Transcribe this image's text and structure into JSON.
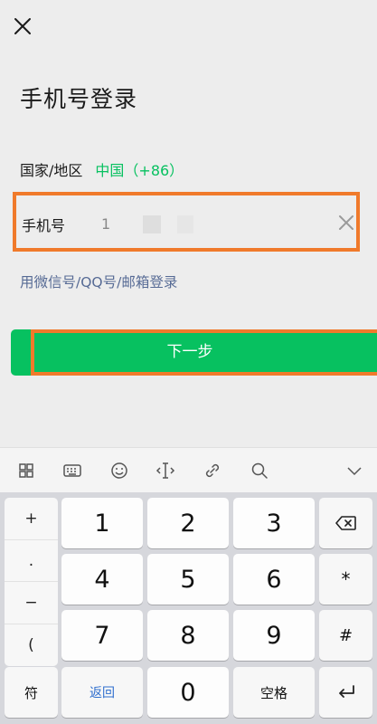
{
  "header": {
    "close_icon": "close-icon",
    "title": "手机号登录"
  },
  "form": {
    "region_label": "国家/地区",
    "region_value": "中国（+86）",
    "phone_label": "手机号",
    "phone_value": "1",
    "clear_icon": "clear-icon"
  },
  "alt_login": "用微信号/QQ号/邮箱登录",
  "next_button": "下一步",
  "keyboard": {
    "toolbar_icons": [
      "grid-icon",
      "keyboard-icon",
      "emoji-icon",
      "cursor-icon",
      "link-icon",
      "search-icon",
      "chevron-down-icon"
    ],
    "side_keys": [
      "+",
      ".",
      "−",
      "("
    ],
    "keys": {
      "k1": "1",
      "k2": "2",
      "k3": "3",
      "k4": "4",
      "k5": "5",
      "k6": "6",
      "k7": "7",
      "k8": "8",
      "k9": "9",
      "k0": "0",
      "star": "*",
      "hash": "#",
      "symbol": "符",
      "back": "返回",
      "space": "空格"
    }
  },
  "colors": {
    "accent_green": "#07c160",
    "link_blue": "#576b95",
    "highlight_orange": "#f07a2b"
  }
}
